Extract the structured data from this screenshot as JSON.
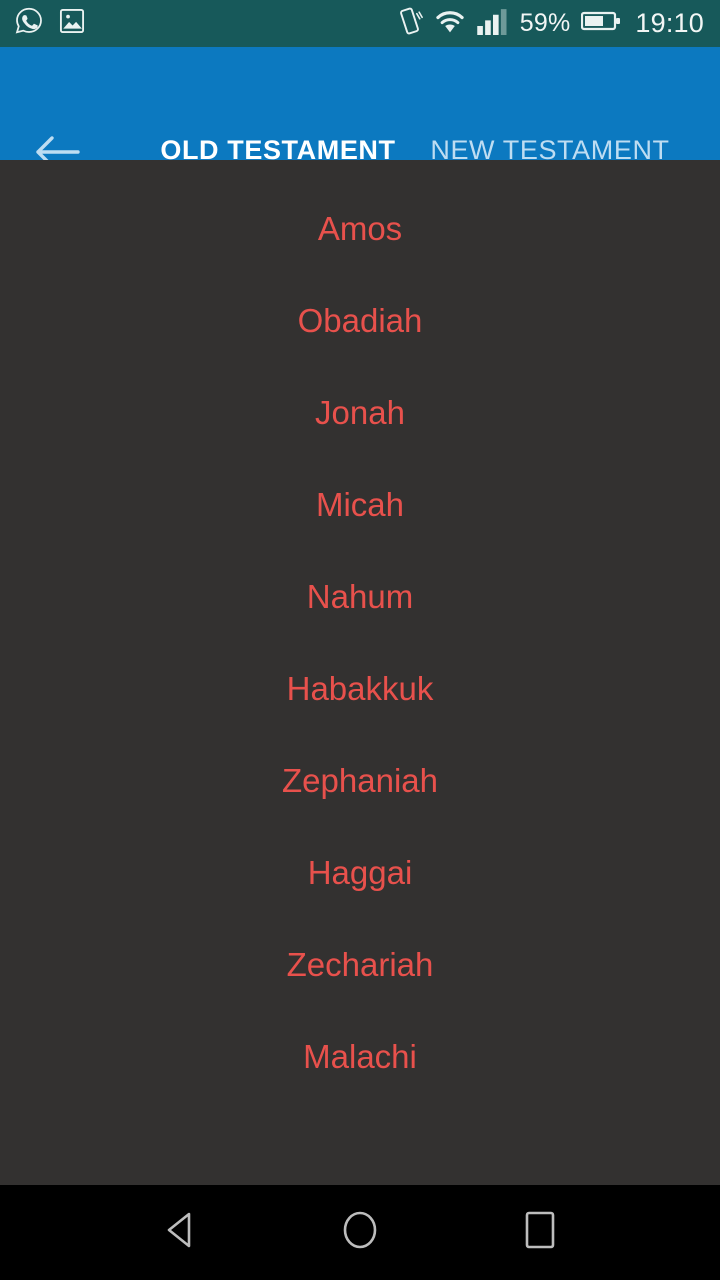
{
  "status_bar": {
    "background_color": "#17595A",
    "left_icons": [
      {
        "name": "whatsapp-icon",
        "label": "WhatsApp"
      },
      {
        "name": "photo-icon",
        "label": "Photo"
      }
    ],
    "right_icons": [
      {
        "name": "vibrate-icon",
        "label": "Vibrate"
      },
      {
        "name": "wifi-icon",
        "label": "Wi-Fi"
      },
      {
        "name": "cellular-signal-icon",
        "label": "Signal"
      },
      {
        "name": "battery-icon",
        "label": "Battery"
      }
    ],
    "battery_percent": "59%",
    "battery_level": 59,
    "clock": "19:10"
  },
  "app_bar": {
    "background_color": "#0C79C0",
    "back_icon": "arrow-left-icon",
    "indicator_color": "#0E8CDB",
    "active_tab_index": 0,
    "tabs": [
      {
        "label": "OLD TESTAMENT",
        "active": true
      },
      {
        "label": "NEW TESTAMENT",
        "active": false
      }
    ]
  },
  "book_list": {
    "background_color": "#333130",
    "item_color": "#E8514C",
    "items": [
      {
        "title": "Amos"
      },
      {
        "title": "Obadiah"
      },
      {
        "title": "Jonah"
      },
      {
        "title": "Micah"
      },
      {
        "title": "Nahum"
      },
      {
        "title": "Habakkuk"
      },
      {
        "title": "Zephaniah"
      },
      {
        "title": "Haggai"
      },
      {
        "title": "Zechariah"
      },
      {
        "title": "Malachi"
      }
    ]
  },
  "nav_bar": {
    "background_color": "#000000",
    "buttons": [
      {
        "name": "nav-back-button",
        "icon": "triangle-left-icon"
      },
      {
        "name": "nav-home-button",
        "icon": "circle-icon"
      },
      {
        "name": "nav-recents-button",
        "icon": "square-icon"
      }
    ]
  }
}
